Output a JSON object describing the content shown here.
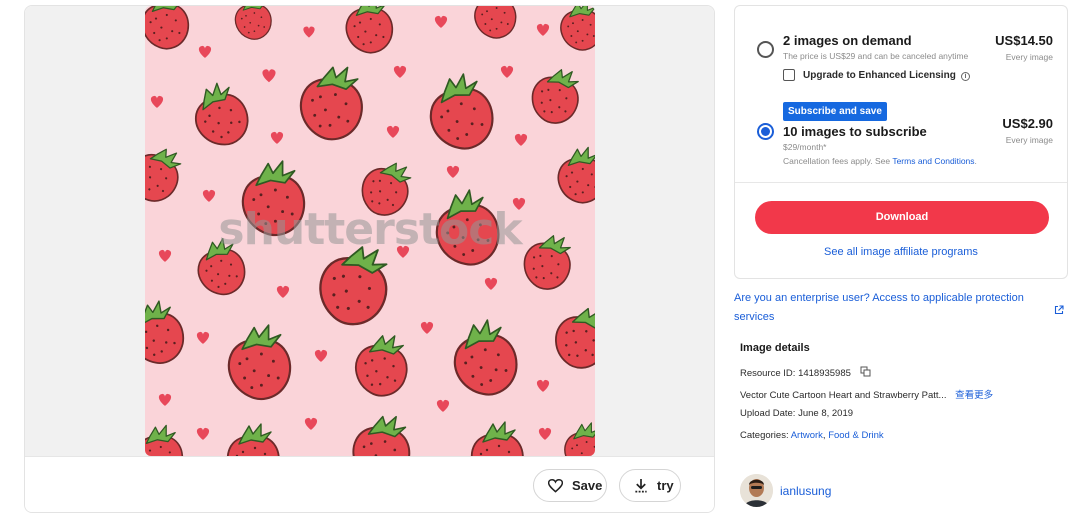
{
  "preview": {
    "watermark": "shutterstock",
    "save_label": "Save",
    "try_label": "try"
  },
  "pricing": {
    "option1": {
      "title": "2 images on demand",
      "subtitle": "The price is US$29 and can be canceled anytime",
      "price": "US$14.50",
      "price_sub": "Every image",
      "selected": false,
      "checkbox_label": "Upgrade to Enhanced Licensing"
    },
    "option2": {
      "badge": "Subscribe and save",
      "title": "10 images to subscribe",
      "subtitle": "$29/month*",
      "note_prefix": "Cancellation fees apply. See ",
      "note_link": "Terms and Conditions",
      "note_suffix": ".",
      "price": "US$2.90",
      "price_sub": "Every image",
      "selected": true
    },
    "download_label": "Download",
    "affiliate_link": "See all image affiliate programs"
  },
  "enterprise_link": "Are you an enterprise user? Access to applicable protection services",
  "details": {
    "title": "Image details",
    "resource_id": "Resource ID: 1418935985",
    "description": "Vector Cute Cartoon Heart and Strawberry Patt...",
    "more_link": "查看更多",
    "upload_date": "Upload Date: June 8, 2019",
    "categories_label": "Categories: ",
    "category1": "Artwork",
    "category_sep": ", ",
    "category2": "Food & Drink"
  },
  "author": {
    "name": "ianlusung"
  },
  "colors": {
    "accent_blue": "#1a5ed8",
    "download_red": "#f2384a",
    "pattern_bg": "#fad4d9",
    "strawberry": "#e5474f",
    "leaf": "#6fb24a"
  },
  "icons": [
    "heart-icon",
    "download-icon",
    "info-icon",
    "external-link-icon",
    "copy-icon"
  ]
}
